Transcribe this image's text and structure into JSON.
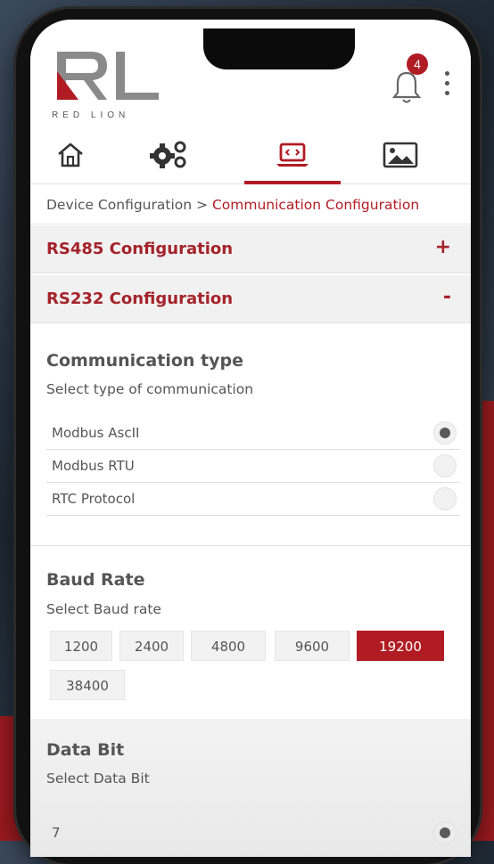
{
  "header": {
    "logo_text": "RED LION",
    "notification_count": "4"
  },
  "tabs": [
    {
      "name": "home",
      "icon": "home-icon"
    },
    {
      "name": "settings",
      "icon": "gears-icon"
    },
    {
      "name": "device",
      "icon": "laptop-code-icon",
      "active": true
    },
    {
      "name": "gallery",
      "icon": "image-icon"
    }
  ],
  "breadcrumb": {
    "parent": "Device Configuration",
    "separator": ">",
    "current": "Communication Configuration"
  },
  "accordions": [
    {
      "title": "RS485 Configuration",
      "sign": "+"
    },
    {
      "title": "RS232 Configuration",
      "sign": "-"
    }
  ],
  "communication": {
    "title": "Communication type",
    "subtitle": "Select type of communication",
    "options": [
      {
        "label": "Modbus AscII",
        "selected": true
      },
      {
        "label": "Modbus RTU",
        "selected": false
      },
      {
        "label": "RTC Protocol",
        "selected": false
      }
    ]
  },
  "baud": {
    "title": "Baud Rate",
    "subtitle": "Select Baud rate",
    "options": [
      "1200",
      "2400",
      "4800",
      "9600",
      "19200",
      "38400"
    ],
    "selected": "19200"
  },
  "data_bit": {
    "title": "Data Bit",
    "subtitle": "Select Data Bit",
    "options": [
      {
        "label": "7",
        "selected": true
      }
    ]
  },
  "colors": {
    "brand_red": "#b11c24",
    "text_grey": "#555555"
  }
}
